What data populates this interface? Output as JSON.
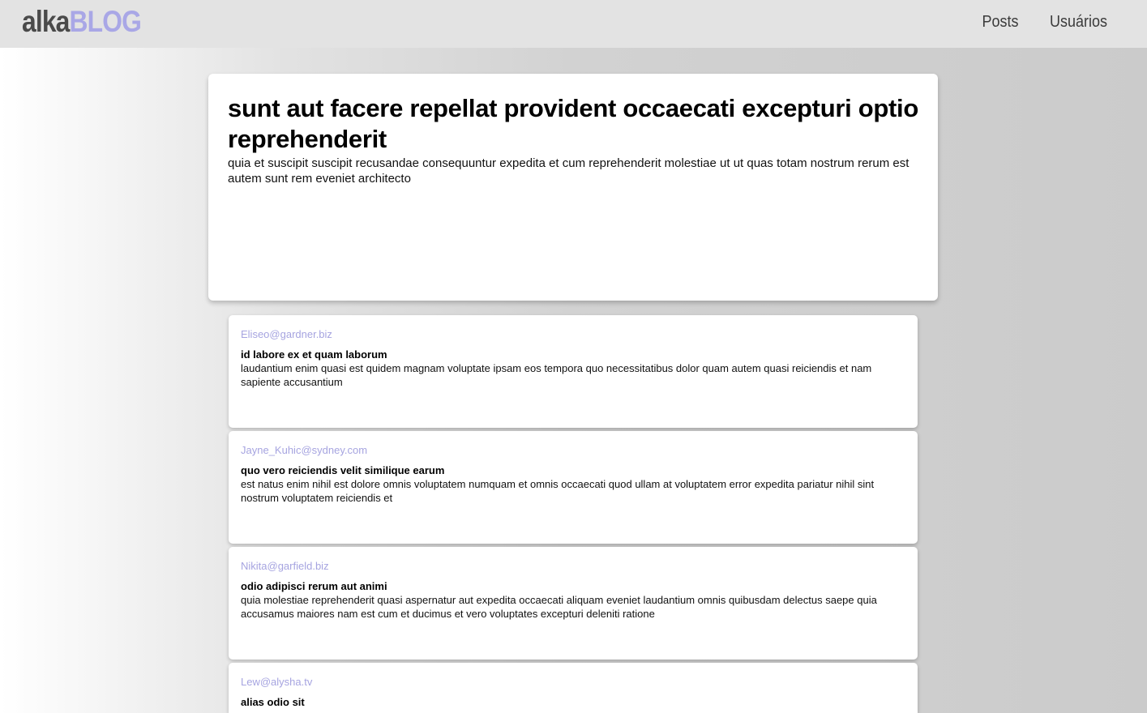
{
  "header": {
    "logo_part1": "alka",
    "logo_part2": "BLOG",
    "nav": [
      {
        "label": "Posts"
      },
      {
        "label": "Usuários"
      }
    ]
  },
  "post": {
    "title": "sunt aut facere repellat provident occaecati excepturi optio reprehenderit",
    "body": "quia et suscipit suscipit recusandae consequuntur expedita et cum reprehenderit molestiae ut ut quas totam nostrum rerum est autem sunt rem eveniet architecto"
  },
  "comments": [
    {
      "email": "Eliseo@gardner.biz",
      "name": "id labore ex et quam laborum",
      "body": "laudantium enim quasi est quidem magnam voluptate ipsam eos tempora quo necessitatibus dolor quam autem quasi reiciendis et nam sapiente accusantium"
    },
    {
      "email": "Jayne_Kuhic@sydney.com",
      "name": "quo vero reiciendis velit similique earum",
      "body": "est natus enim nihil est dolore omnis voluptatem numquam et omnis occaecati quod ullam at voluptatem error expedita pariatur nihil sint nostrum voluptatem reiciendis et"
    },
    {
      "email": "Nikita@garfield.biz",
      "name": "odio adipisci rerum aut animi",
      "body": "quia molestiae reprehenderit quasi aspernatur aut expedita occaecati aliquam eveniet laudantium omnis quibusdam delectus saepe quia accusamus maiores nam est cum et ducimus et vero voluptates excepturi deleniti ratione"
    },
    {
      "email": "Lew@alysha.tv",
      "name": "alias odio sit",
      "body": ""
    }
  ],
  "colors": {
    "accent": "#a9a7e6",
    "header_bg": "#e3e3e3"
  }
}
